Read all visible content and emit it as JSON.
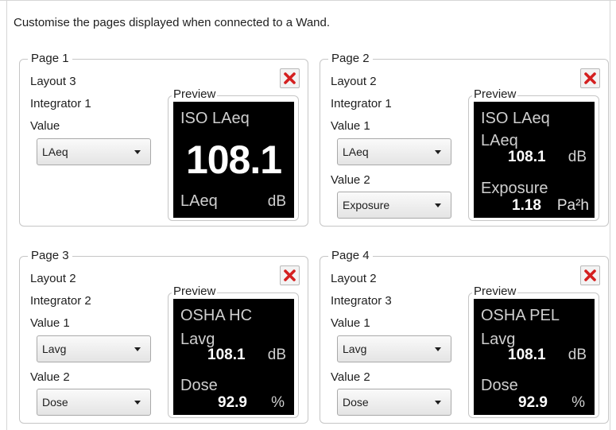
{
  "heading": "Customise the pages displayed when connected to a Wand.",
  "pages": [
    {
      "legend": "Page 1",
      "layout": "Layout 3",
      "integrator": "Integrator 1",
      "value_label": "Value",
      "value_selected": "LAeq",
      "preview_label": "Preview",
      "screen": {
        "title": "ISO LAeq",
        "big_value": "108.1",
        "label": "LAeq",
        "unit": "dB"
      }
    },
    {
      "legend": "Page 2",
      "layout": "Layout 2",
      "integrator": "Integrator 1",
      "value1_label": "Value 1",
      "value1_selected": "LAeq",
      "value2_label": "Value 2",
      "value2_selected": "Exposure",
      "preview_label": "Preview",
      "screen": {
        "title": "ISO LAeq",
        "label1": "LAeq",
        "value1": "108.1",
        "unit1": "dB",
        "label2": "Exposure",
        "value2": "1.18",
        "unit2": "Pa²h"
      }
    },
    {
      "legend": "Page 3",
      "layout": "Layout 2",
      "integrator": "Integrator 2",
      "value1_label": "Value 1",
      "value1_selected": "Lavg",
      "value2_label": "Value 2",
      "value2_selected": "Dose",
      "preview_label": "Preview",
      "screen": {
        "title": "OSHA HC",
        "label1": "Lavg",
        "value1": "108.1",
        "unit1": "dB",
        "label2": "Dose",
        "value2": "92.9",
        "unit2": "%"
      }
    },
    {
      "legend": "Page 4",
      "layout": "Layout 2",
      "integrator": "Integrator 3",
      "value1_label": "Value 1",
      "value1_selected": "Lavg",
      "value2_label": "Value 2",
      "value2_selected": "Dose",
      "preview_label": "Preview",
      "screen": {
        "title": "OSHA PEL",
        "label1": "Lavg",
        "value1": "108.1",
        "unit1": "dB",
        "label2": "Dose",
        "value2": "92.9",
        "unit2": "%"
      }
    }
  ],
  "colors": {
    "close_icon": "#d42020",
    "screen_bg": "#000000"
  },
  "icons": {
    "close": "close-icon",
    "dropdown": "chevron-down-icon"
  }
}
